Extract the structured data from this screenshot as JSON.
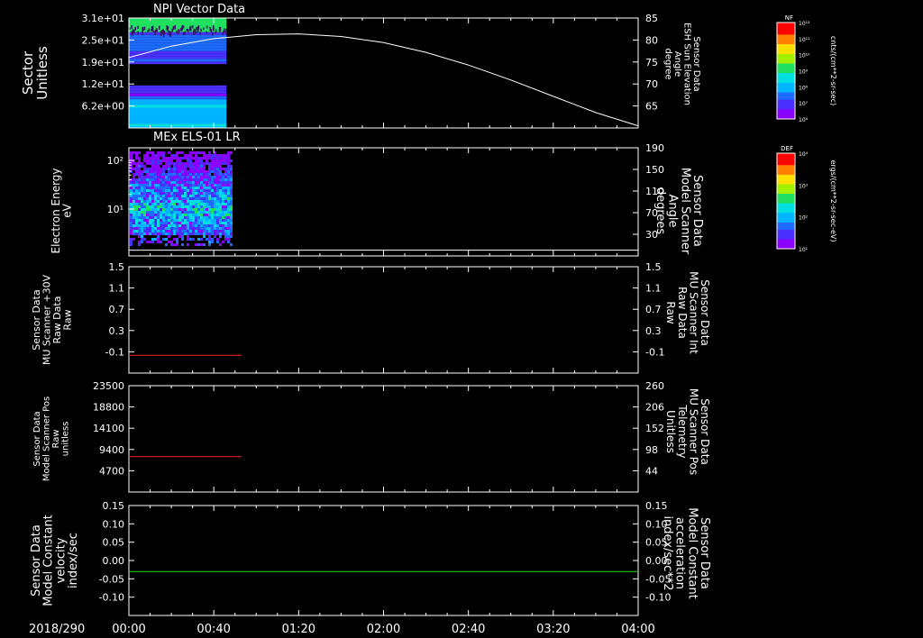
{
  "date_label": "2018/290",
  "time_axis": {
    "ticks": [
      "00:00",
      "00:40",
      "01:20",
      "02:00",
      "02:40",
      "03:20",
      "04:00"
    ],
    "range": [
      "00:00",
      "04:00"
    ]
  },
  "colors": {
    "background": "#000000",
    "axis": "#ffffff",
    "red_trace": "#ff2020",
    "green_trace": "#20e020",
    "spectrogram_palette": [
      "#8a00ff",
      "#4a30ff",
      "#1e6bff",
      "#00b4ff",
      "#00e0e0",
      "#20e060",
      "#a0f000",
      "#ffe000",
      "#ff8000",
      "#ff0000"
    ]
  },
  "colorbars": [
    {
      "title": "NF",
      "tick_labels": [
        "10¹²",
        "10¹¹",
        "10¹⁰",
        "10⁹",
        "10⁸",
        "10⁷",
        "10⁶"
      ],
      "units": "cnts/(cm**2-sr-sec)"
    },
    {
      "title": "DEF",
      "tick_labels": [
        "10⁴",
        "10³",
        "10²",
        "10¹"
      ],
      "units": "ergs/(cm**2-sr-sec-eV)"
    }
  ],
  "chart_data": [
    {
      "type": "heatmap",
      "title": "NPI Vector Data",
      "ylabel": [
        "Sector",
        "Unitless"
      ],
      "y_ticks": [
        "3.1e+01",
        "2.5e+01",
        "1.9e+01",
        "1.2e+01",
        "6.2e+00"
      ],
      "data_time_range": [
        "00:00",
        "00:46"
      ],
      "sector_bands": [
        {
          "from_sector": 27,
          "to_sector": 31,
          "level": 0.55
        },
        {
          "from_sector": 21,
          "to_sector": 27,
          "level": 0.25
        },
        {
          "from_sector": 18,
          "to_sector": 21,
          "level": 0.2
        },
        {
          "from_sector": 8,
          "to_sector": 12,
          "level": 0.15
        },
        {
          "from_sector": 0,
          "to_sector": 8,
          "level": 0.35
        }
      ],
      "overlay_line": {
        "label": [
          "Sensor Data",
          "ESH Sun Elevation",
          "Angle",
          "degree"
        ],
        "right_ticks": [
          "85",
          "80",
          "75",
          "70",
          "65"
        ],
        "ylim": [
          60,
          85
        ],
        "x": [
          "00:00",
          "00:20",
          "00:40",
          "01:00",
          "01:20",
          "01:40",
          "02:00",
          "02:20",
          "02:40",
          "03:00",
          "03:20",
          "03:40",
          "04:00"
        ],
        "values": [
          76.0,
          78.6,
          80.3,
          81.2,
          81.4,
          80.8,
          79.4,
          77.2,
          74.3,
          70.9,
          67.2,
          63.5,
          60.5
        ]
      }
    },
    {
      "type": "heatmap",
      "title": "MEx ELS-01 LR",
      "ylabel": [
        "Electron Energy",
        "eV"
      ],
      "y_ticks": [
        "10²",
        "10¹"
      ],
      "y_scale": "log",
      "data_time_range": [
        "00:00",
        "00:48"
      ],
      "overlay_line": {
        "label": [
          "Sensor Data",
          "Model Scanner",
          "Angle",
          "degrees"
        ],
        "right_ticks": [
          "190",
          "150",
          "110",
          "70",
          "30"
        ],
        "ylim": [
          0,
          190
        ],
        "x": [
          "00:00",
          "04:00"
        ],
        "values": [
          10,
          10
        ]
      }
    },
    {
      "type": "line",
      "ylabel": [
        "Sensor Data",
        "MU Scanner +30V",
        "Raw Data",
        "Raw"
      ],
      "y_ticks": [
        "1.5",
        "1.1",
        "0.7",
        "0.3",
        "-0.1"
      ],
      "ylim": [
        -0.3,
        1.5
      ],
      "right_axis": {
        "label": [
          "Sensor Data",
          "MU Scanner Int",
          "Raw Data",
          "Raw"
        ],
        "ticks": [
          "1.5",
          "1.1",
          "0.7",
          "0.3",
          "-0.1"
        ]
      },
      "series": [
        {
          "x": [
            "00:00",
            "00:53"
          ],
          "values": [
            0.0,
            0.0
          ]
        }
      ]
    },
    {
      "type": "line",
      "ylabel": [
        "Sensor Data",
        "Model Scanner Pos",
        "Raw",
        "unitless"
      ],
      "y_ticks": [
        "23500",
        "18800",
        "14100",
        "9400",
        "4700"
      ],
      "ylim": [
        0,
        23500
      ],
      "right_axis": {
        "label": [
          "Sensor Data",
          "MU Scanner Pos",
          "Telemetry",
          "Unitless"
        ],
        "ticks": [
          "260",
          "206",
          "152",
          "98",
          "44"
        ]
      },
      "series": [
        {
          "x": [
            "00:00",
            "00:53"
          ],
          "values": [
            7800,
            7800
          ]
        }
      ]
    },
    {
      "type": "line",
      "ylabel": [
        "Sensor Data",
        "Model Constant",
        "velocity",
        "index/sec"
      ],
      "y_ticks": [
        "0.15",
        "0.10",
        "0.05",
        "0.00",
        "-0.05",
        "-0.10"
      ],
      "ylim": [
        -0.1,
        0.15
      ],
      "right_axis": {
        "label": [
          "Sensor Data",
          "Model Constant",
          "acceleration",
          "index/sec**2"
        ],
        "ticks": [
          "0.15",
          "0.10",
          "0.05",
          "0.00",
          "-0.05",
          "-0.10"
        ]
      },
      "series": [
        {
          "x": [
            "00:00",
            "04:00"
          ],
          "values": [
            0.0,
            0.0
          ]
        }
      ]
    }
  ]
}
